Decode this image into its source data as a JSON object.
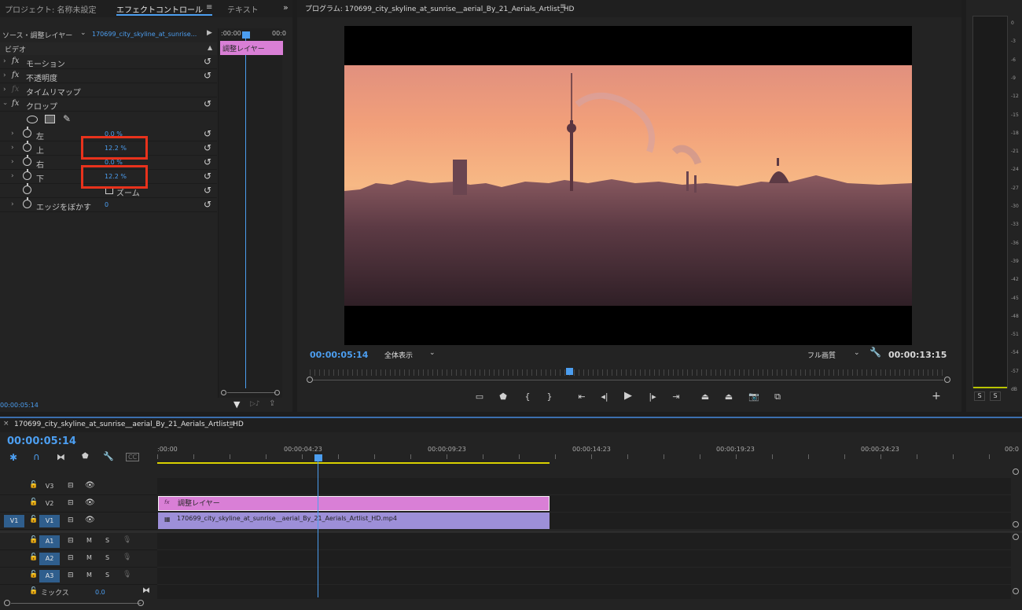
{
  "effect_controls": {
    "tabs": {
      "project": "プロジェクト: 名称未設定",
      "effect_controls": "エフェクトコントロール",
      "text": "テキスト"
    },
    "source_label": "ソース・調整レイヤー",
    "source_clip": "170699_city_skyline_at_sunrise...",
    "mini_timecode": ":00:00",
    "mini_timecode_end": "00:0",
    "clip_label": "調整レイヤー",
    "section_video": "ビデオ",
    "effects": {
      "motion": "モーション",
      "opacity": "不透明度",
      "time_remap": "タイムリマップ",
      "crop": "クロップ"
    },
    "crop_props": {
      "left_label": "左",
      "left_value": "0.0 %",
      "top_label": "上",
      "top_value": "12.2 %",
      "right_label": "右",
      "right_value": "0.0 %",
      "bottom_label": "下",
      "bottom_value": "12.2 %",
      "zoom_label": "ズーム",
      "feather_label": "エッジをぼかす",
      "feather_value": "0"
    },
    "bottom_timecode": "00:00:05:14"
  },
  "program_monitor": {
    "title": "プログラム: 170699_city_skyline_at_sunrise__aerial_By_21_Aerials_Artlist_HD",
    "current_timecode": "00:00:05:14",
    "fit_label": "全体表示",
    "quality_label": "フル画質",
    "duration_timecode": "00:00:13:15",
    "playhead_fraction": 0.402
  },
  "audio_meter": {
    "db_labels": [
      "0",
      "-3",
      "-6",
      "-9",
      "-12",
      "-15",
      "-18",
      "-21",
      "-24",
      "-27",
      "-30",
      "-33",
      "-36",
      "-39",
      "-42",
      "-45",
      "-48",
      "-51",
      "-54",
      "-57",
      "dB"
    ],
    "solo_left": "S",
    "solo_right": "S"
  },
  "timeline": {
    "sequence_name": "170699_city_skyline_at_sunrise__aerial_By_21_Aerials_Artlist_HD",
    "timecode": "00:00:05:14",
    "ruler_labels": [
      ":00:00",
      "00:00:04:23",
      "00:00:09:23",
      "00:00:14:23",
      "00:00:19:23",
      "00:00:24:23",
      "00:0"
    ],
    "tracks": {
      "v3": "V3",
      "v2": "V2",
      "v1": "V1",
      "v1_source": "V1",
      "a1": "A1",
      "a2": "A2",
      "a3": "A3",
      "mute": "M",
      "solo": "S",
      "mix_label": "ミックス",
      "mix_value": "0.0"
    },
    "clips": {
      "adjustment": "調整レイヤー",
      "video": "170699_city_skyline_at_sunrise__aerial_By_21_Aerials_Artlist_HD.mp4"
    },
    "colors": {
      "adjustment_clip": "#d97fd6",
      "video_clip": "#9d8fd8",
      "playhead": "#4c9ef0",
      "work_area": "#d8d000"
    }
  }
}
